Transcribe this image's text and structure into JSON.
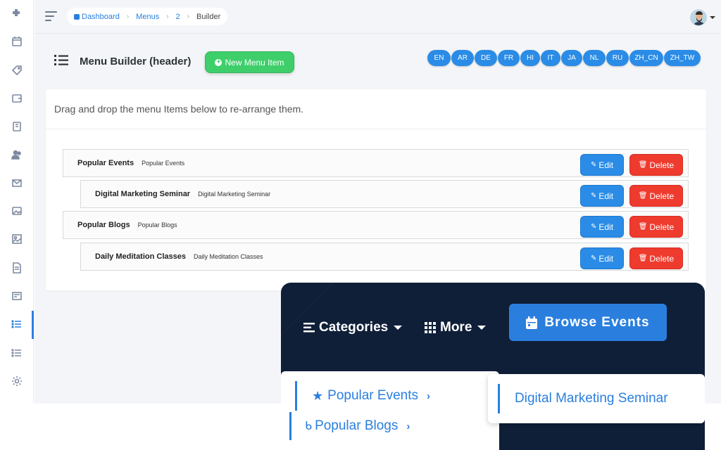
{
  "breadcrumb": {
    "items": [
      "Dashboard",
      "Menus",
      "2",
      "Builder"
    ]
  },
  "header": {
    "title": "Menu Builder (header)",
    "new_button": "New Menu Item"
  },
  "languages": [
    "EN",
    "AR",
    "DE",
    "FR",
    "HI",
    "IT",
    "JA",
    "NL",
    "RU",
    "ZH_CN",
    "ZH_TW"
  ],
  "card": {
    "instruction": "Drag and drop the menu Items below to re-arrange them."
  },
  "menu_items": [
    {
      "title": "Popular Events",
      "subtitle": "Popular Events",
      "edit": "Edit",
      "delete": "Delete"
    },
    {
      "title": "Digital Marketing Seminar",
      "subtitle": "Digital Marketing Seminar",
      "edit": "Edit",
      "delete": "Delete"
    },
    {
      "title": "Popular Blogs",
      "subtitle": "Popular Blogs",
      "edit": "Edit",
      "delete": "Delete"
    },
    {
      "title": "Daily Meditation Classes",
      "subtitle": "Daily Meditation Classes",
      "edit": "Edit",
      "delete": "Delete"
    }
  ],
  "preview": {
    "categories": "Categories",
    "more": "More",
    "browse": "Browse Events",
    "dropdown": [
      "Popular Events",
      "Popular Blogs"
    ],
    "submenu": "Digital Marketing Seminar"
  },
  "colors": {
    "accent": "#2a7fde",
    "success": "#3ecf6b",
    "danger": "#ee3b2e",
    "navy": "#0f1f38"
  },
  "icons": [
    "puzzle-icon",
    "calendar-icon",
    "tag-icon",
    "wallet-icon",
    "book-icon",
    "users-icon",
    "mail-icon",
    "image-icon",
    "picture-icon",
    "file-icon",
    "newspaper-icon",
    "list-icon",
    "list-alt-icon",
    "gear-icon"
  ]
}
